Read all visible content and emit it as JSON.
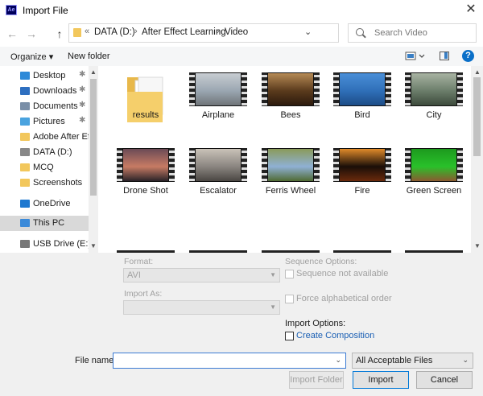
{
  "window": {
    "title": "Import File",
    "app_badge": "Ae",
    "close_glyph": "✕"
  },
  "nav": {
    "back_glyph": "←",
    "forward_glyph": "→",
    "up_glyph": "↑",
    "breadcrumb": {
      "prefix": "«",
      "items": [
        "DATA (D:)",
        "After Effect Learning",
        "Video"
      ],
      "separator": "›",
      "dropdown_glyph": "⌄"
    },
    "refresh_glyph": "↻",
    "search": {
      "placeholder": "Search Video"
    }
  },
  "toolbar": {
    "organize": "Organize ▾",
    "new_folder": "New folder",
    "help_glyph": "?"
  },
  "sidebar": {
    "items": [
      {
        "label": "Desktop",
        "icon": "desktop-icon",
        "color": "#2e8ad8",
        "pinned": true
      },
      {
        "label": "Downloads",
        "icon": "download-icon",
        "color": "#2e6fc0",
        "pinned": true
      },
      {
        "label": "Documents",
        "icon": "documents-icon",
        "color": "#7a8fa8",
        "pinned": true
      },
      {
        "label": "Pictures",
        "icon": "pictures-icon",
        "color": "#4aa3df",
        "pinned": true
      },
      {
        "label": "Adobe After Effe",
        "icon": "folder-icon",
        "color": "#f2c75c",
        "pinned": false
      },
      {
        "label": "DATA (D:)",
        "icon": "drive-icon",
        "color": "#888888",
        "pinned": false
      },
      {
        "label": "MCQ",
        "icon": "folder-icon",
        "color": "#f2c75c",
        "pinned": false
      },
      {
        "label": "Screenshots",
        "icon": "folder-icon",
        "color": "#f2c75c",
        "pinned": false
      },
      {
        "label": "OneDrive",
        "icon": "onedrive-icon",
        "color": "#1e78d0",
        "pinned": false
      },
      {
        "label": "This PC",
        "icon": "pc-icon",
        "color": "#3b8ad9",
        "pinned": false,
        "selected": true
      },
      {
        "label": "USB Drive (E:)",
        "icon": "usb-drive-icon",
        "color": "#777777",
        "pinned": false
      }
    ],
    "pin_glyph": "📌"
  },
  "files": [
    {
      "name": "results",
      "kind": "folder"
    },
    {
      "name": "Airplane",
      "kind": "video",
      "colors": [
        "#9aa6b1",
        "#c8cdd2",
        "#6f7478"
      ]
    },
    {
      "name": "Bees",
      "kind": "video",
      "colors": [
        "#5a3a1c",
        "#b58a55",
        "#2b1a0d"
      ]
    },
    {
      "name": "Bird",
      "kind": "video",
      "colors": [
        "#2f6fb8",
        "#4a8fd8",
        "#1c4c86"
      ]
    },
    {
      "name": "City",
      "kind": "video",
      "colors": [
        "#6b7d6a",
        "#a8b3a2",
        "#3c4a3b"
      ]
    },
    {
      "name": "Drone Shot",
      "kind": "video",
      "colors": [
        "#c77b64",
        "#6b4b56",
        "#2a2328"
      ]
    },
    {
      "name": "Escalator",
      "kind": "video",
      "colors": [
        "#8a8580",
        "#c9c2b8",
        "#4a4642"
      ]
    },
    {
      "name": "Ferris Wheel",
      "kind": "video",
      "colors": [
        "#8fb0d4",
        "#8a9a5a",
        "#4f6a33"
      ]
    },
    {
      "name": "Fire",
      "kind": "video",
      "colors": [
        "#1a0e08",
        "#e08a2a",
        "#6a2a0c"
      ]
    },
    {
      "name": "Green Screen",
      "kind": "video",
      "colors": [
        "#29c12a",
        "#1d9a1e",
        "#8a5a30"
      ]
    }
  ],
  "options": {
    "format_label": "Format:",
    "format_value": "AVI",
    "import_as_label": "Import As:",
    "import_as_value": "",
    "sequence_label": "Sequence Options:",
    "sequence_not_available": "Sequence not available",
    "force_alpha": "Force alphabetical order",
    "import_options_label": "Import Options:",
    "create_composition": "Create Composition"
  },
  "footer": {
    "file_name_label": "File name:",
    "file_name_value": "",
    "file_type": "All Acceptable Files",
    "import_folder": "Import Folder",
    "import": "Import",
    "cancel": "Cancel"
  }
}
